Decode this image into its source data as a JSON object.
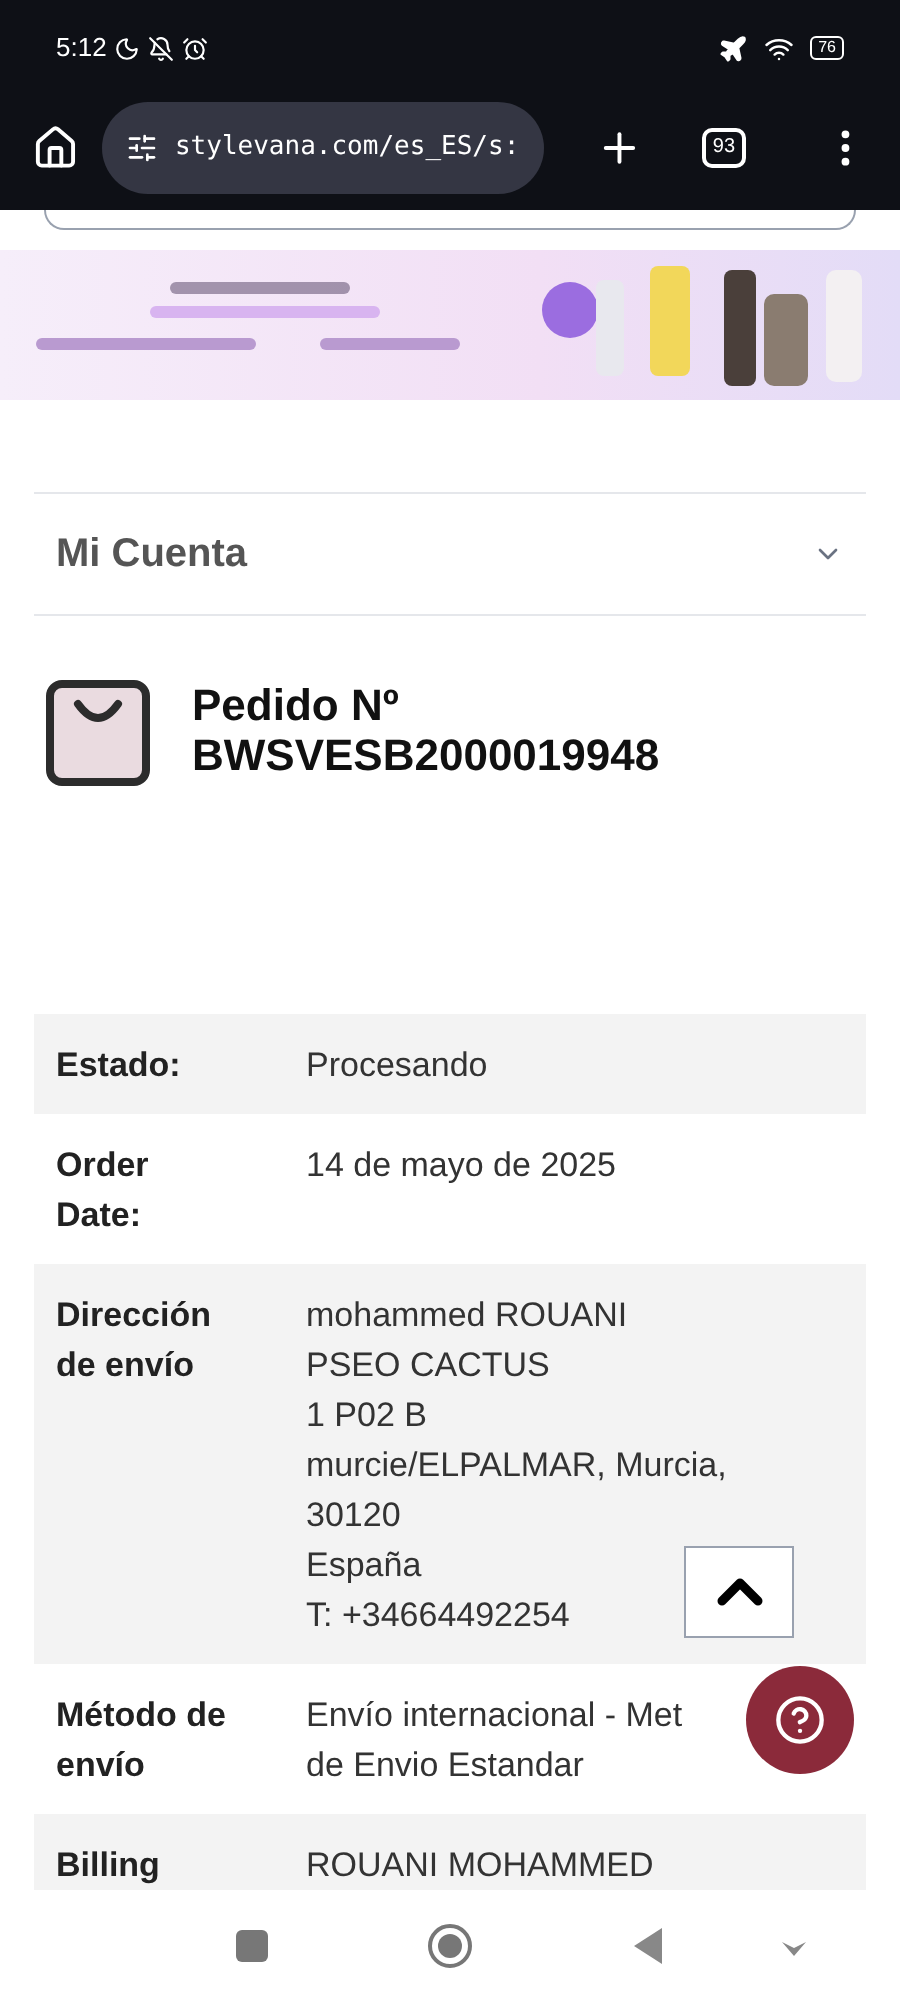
{
  "status_bar": {
    "time": "5:12",
    "battery": "76"
  },
  "browser": {
    "url": "stylevana.com/es_ES/s:",
    "tab_count": "93"
  },
  "account_menu": {
    "label": "Mi Cuenta",
    "expanded": false
  },
  "order": {
    "title": "Pedido Nº",
    "number": "BWSVESB2000019948"
  },
  "details": [
    {
      "label": [
        "Estado:"
      ],
      "value": [
        "Procesando"
      ]
    },
    {
      "label": [
        "Order",
        "Date:"
      ],
      "value": [
        "14 de mayo de 2025"
      ]
    },
    {
      "label": [
        "Dirección",
        "de envío"
      ],
      "value": [
        "mohammed ROUANI",
        "PSEO CACTUS",
        "1 P02 B",
        "murcie/ELPALMAR, Murcia,",
        "30120",
        "España",
        "T: +34664492254"
      ]
    },
    {
      "label": [
        "Método de",
        "envío"
      ],
      "value": [
        "Envío internacional - Met",
        "de Envio Estandar"
      ]
    },
    {
      "label": [
        "Billing"
      ],
      "value": [
        "ROUANI MOHAMMED"
      ]
    }
  ]
}
